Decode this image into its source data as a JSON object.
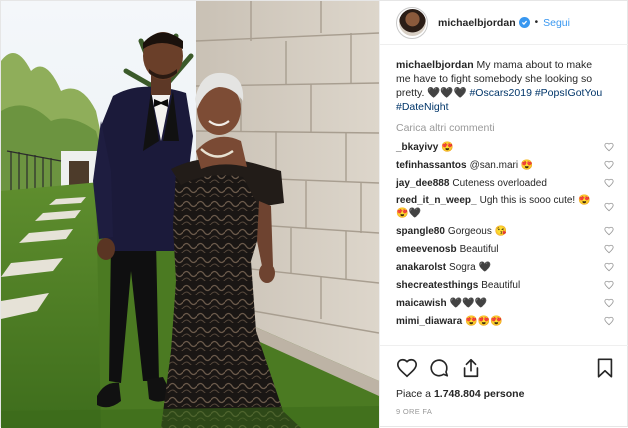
{
  "header": {
    "username": "michaelbjordan",
    "separator": "•",
    "follow_label": "Segui"
  },
  "caption": {
    "username": "michaelbjordan",
    "text": "My mama about to make me have to fight somebody she looking so pretty. 🖤🖤🖤",
    "hashtags": [
      "#Oscars2019",
      "#PopsIGotYou",
      "#DateNight"
    ]
  },
  "load_more_label": "Carica altri commenti",
  "comments": [
    {
      "user": "_bkayivy",
      "text": "😍"
    },
    {
      "user": "tefinhassantos",
      "text": "@san.mari 😍"
    },
    {
      "user": "jay_dee888",
      "text": "Cuteness overloaded"
    },
    {
      "user": "reed_it_n_weep_",
      "text": "Ugh this is sooo cute! 😍😍🖤"
    },
    {
      "user": "spangle80",
      "text": "Gorgeous 😘"
    },
    {
      "user": "emeevenosb",
      "text": "Beautiful"
    },
    {
      "user": "anakarolst",
      "text": "Sogra 🖤"
    },
    {
      "user": "shecreatesthings",
      "text": "Beautiful"
    },
    {
      "user": "maicawish",
      "text": "🖤🖤🖤"
    },
    {
      "user": "mimi_diawara",
      "text": "😍😍😍"
    }
  ],
  "actions": {
    "like_icon": "heart-icon",
    "comment_icon": "comment-icon",
    "share_icon": "share-icon",
    "save_icon": "bookmark-icon"
  },
  "likes": {
    "prefix": "Piace a",
    "count": "1.748.804",
    "suffix": "persone"
  },
  "timestamp": "9 ore fa",
  "colors": {
    "link": "#3897f0",
    "hashtag": "#003569",
    "muted": "#999999",
    "text": "#262626"
  }
}
